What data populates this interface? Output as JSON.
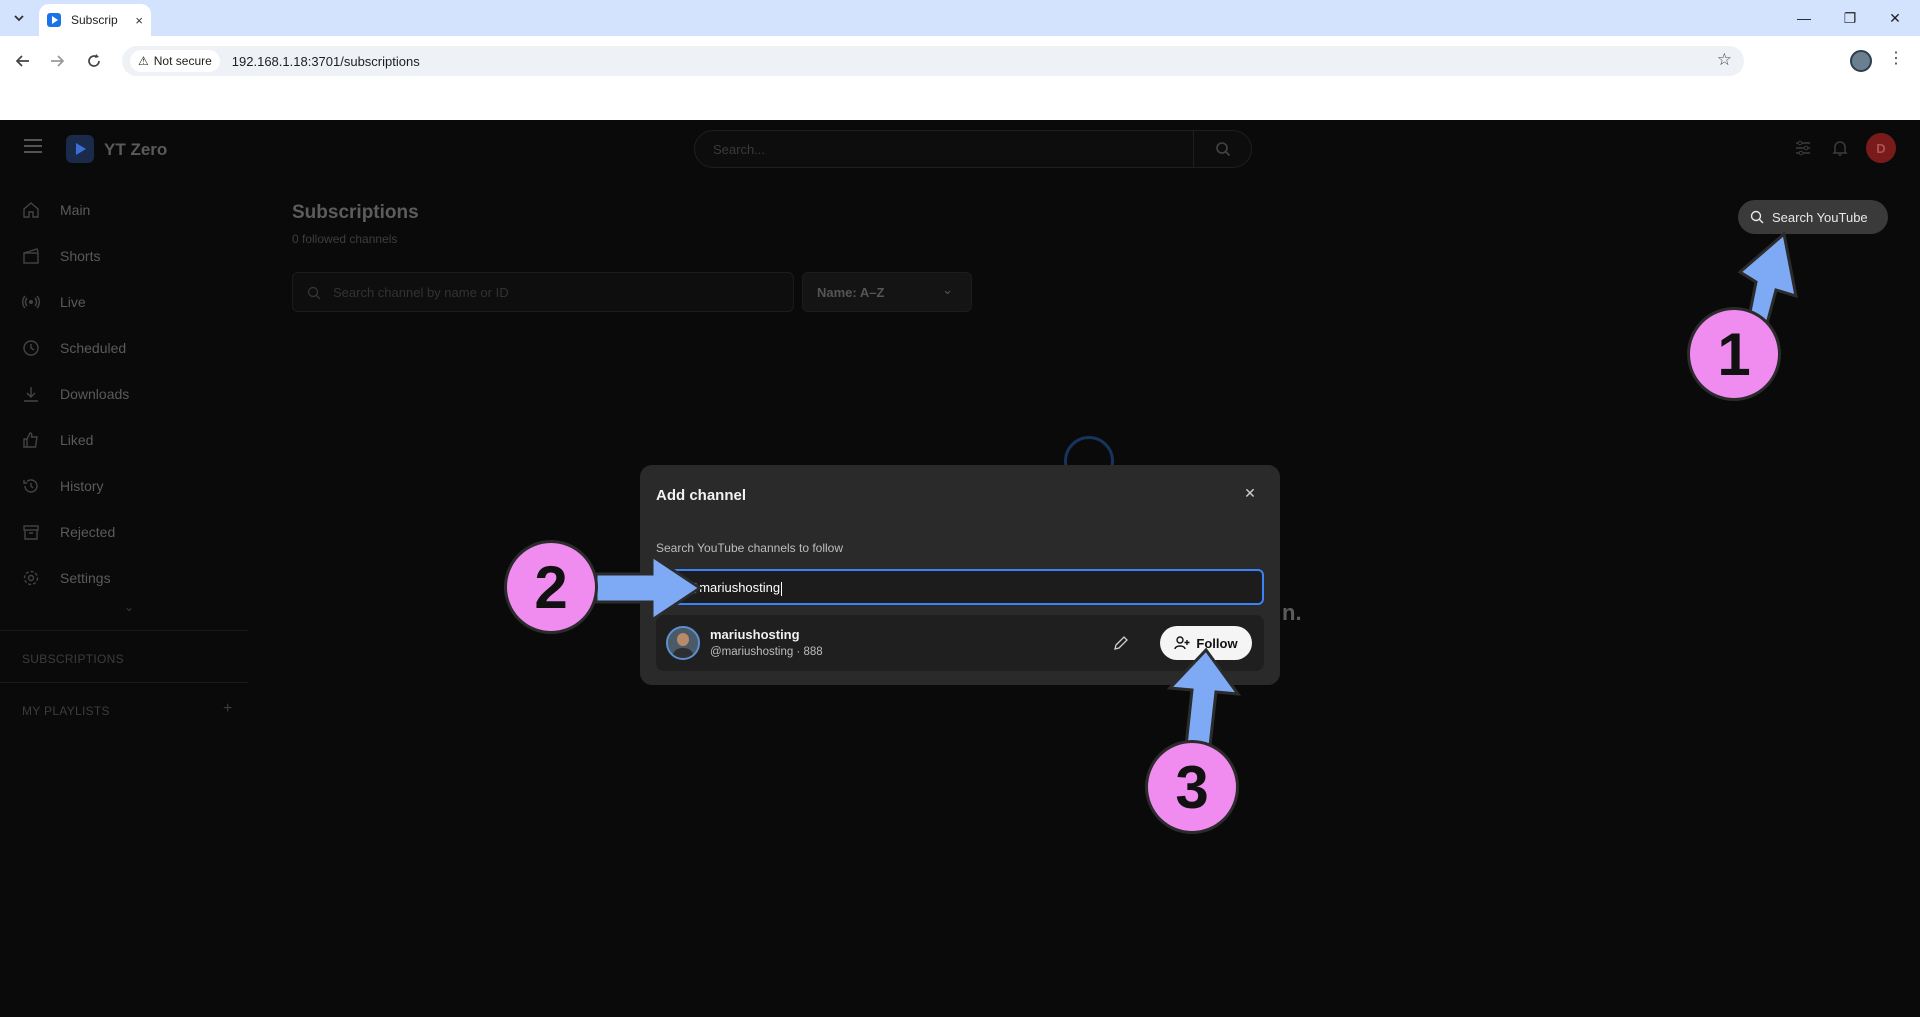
{
  "browser": {
    "tab_title": "Subscrip",
    "tab_close": "×",
    "tab_dropdown": "⌄",
    "security_label": "Not secure",
    "url": "192.168.1.18:3701/subscriptions",
    "controls": {
      "minimize": "—",
      "restore": "❐",
      "close": "✕"
    }
  },
  "app": {
    "brand": "YT Zero",
    "search_placeholder": "Search...",
    "avatar_initial": "D",
    "accent_color": "#3b82f6"
  },
  "sidebar": {
    "items": [
      {
        "label": "Main",
        "icon": "home-icon"
      },
      {
        "label": "Shorts",
        "icon": "clapper-icon"
      },
      {
        "label": "Live",
        "icon": "broadcast-icon"
      },
      {
        "label": "Scheduled",
        "icon": "clock-icon"
      },
      {
        "label": "Downloads",
        "icon": "download-icon"
      },
      {
        "label": "Liked",
        "icon": "thumbs-up-icon"
      },
      {
        "label": "History",
        "icon": "history-icon"
      },
      {
        "label": "Rejected",
        "icon": "archive-icon"
      },
      {
        "label": "Settings",
        "icon": "gear-icon"
      }
    ],
    "sections": {
      "subscriptions": "SUBSCRIPTIONS",
      "playlists": "MY PLAYLISTS"
    }
  },
  "page": {
    "title": "Subscriptions",
    "subtitle": "0 followed channels",
    "channel_search_placeholder": "Search channel by name or ID",
    "sort_value": "Name: A–Z",
    "search_youtube_label": "Search YouTube",
    "background_fragment": "n."
  },
  "modal": {
    "title": "Add channel",
    "label": "Search YouTube channels to follow",
    "input_value": "@mariushosting",
    "result": {
      "name": "mariushosting",
      "meta": "@mariushosting · 888",
      "follow_label": "Follow"
    }
  },
  "annotations": {
    "step1": "1",
    "step2": "2",
    "step3": "3",
    "color": "#f08cf0",
    "arrow_color": "#7eaaf5"
  }
}
